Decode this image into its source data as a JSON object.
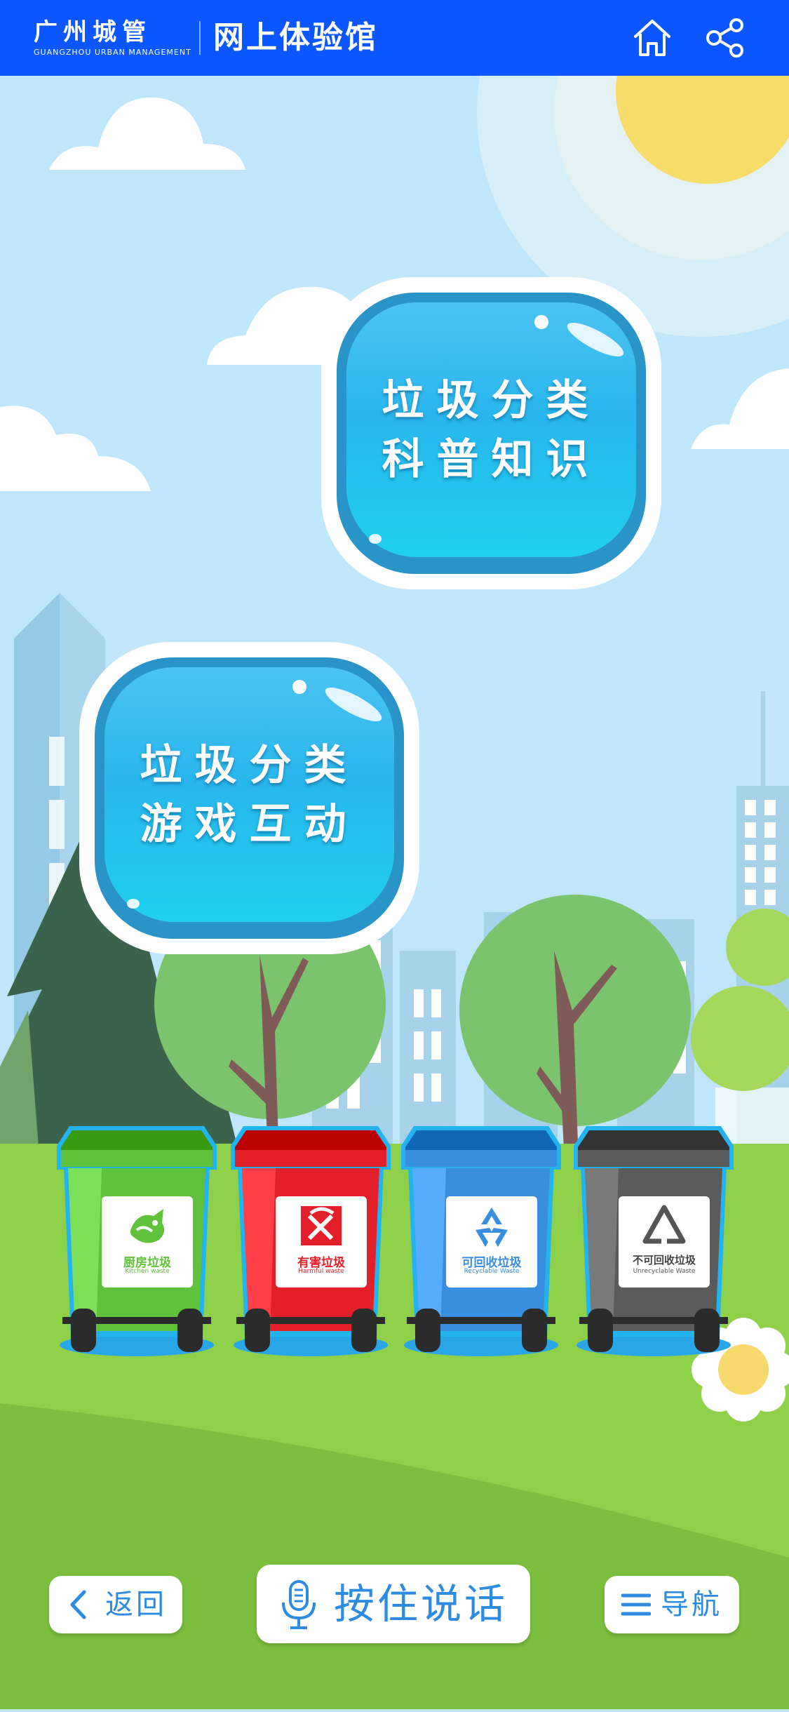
{
  "header": {
    "brand_cn": "广州城管",
    "brand_en": "GUANGZHOU URBAN MANAGEMENT",
    "title": "网上体验馆",
    "home_icon": "home-icon",
    "share_icon": "share-icon"
  },
  "bubbles": {
    "knowledge": {
      "line1": "垃圾分类",
      "line2": "科普知识"
    },
    "game": {
      "line1": "垃圾分类",
      "line2": "游戏互动"
    }
  },
  "bins": [
    {
      "cn": "厨房垃圾",
      "en": "Kitchen waste",
      "color": "#5fc23a",
      "icon": "fish-bone-icon"
    },
    {
      "cn": "有害垃圾",
      "en": "Harmful waste",
      "color": "#e3202a",
      "icon": "battery-icon"
    },
    {
      "cn": "可回收垃圾",
      "en": "Recyclable Waste",
      "color": "#3a8ee0",
      "icon": "recycle-icon"
    },
    {
      "cn": "不可回收垃圾",
      "en": "Unrecyclable Waste",
      "color": "#5b5b5b",
      "icon": "non-recycle-icon"
    }
  ],
  "bottom": {
    "back_label": "返回",
    "talk_label": "按住说话",
    "nav_label": "导航"
  },
  "colors": {
    "header_bg": "#0b56ff",
    "accent": "#2d8be0"
  }
}
